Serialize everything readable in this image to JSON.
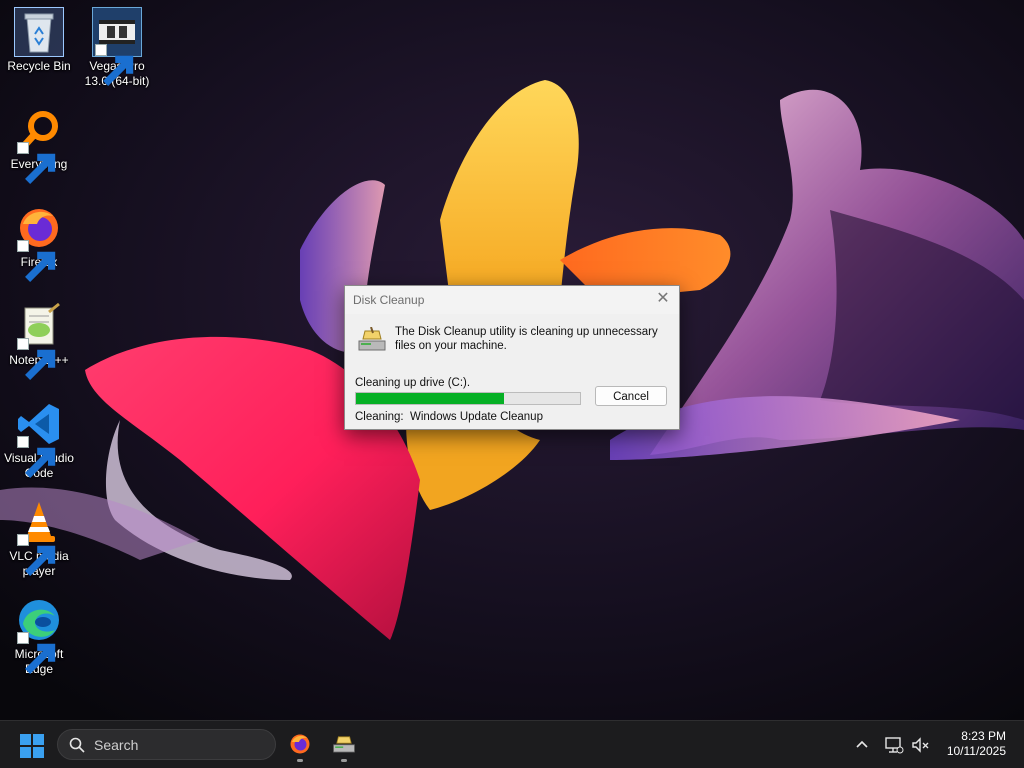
{
  "desktop": {
    "icons": [
      {
        "label": "Recycle Bin",
        "icon": "recycle-bin-icon"
      },
      {
        "label": "Vegas Pro 13.0 (64-bit)",
        "icon": "vegas-pro-icon"
      },
      {
        "label": "Everything",
        "icon": "everything-search-icon"
      },
      {
        "label": "Firefox",
        "icon": "firefox-icon"
      },
      {
        "label": "Notepad++",
        "icon": "notepad-plus-plus-icon"
      },
      {
        "label": "Visual Studio Code",
        "icon": "vscode-icon"
      },
      {
        "label": "VLC media player",
        "icon": "vlc-icon"
      },
      {
        "label": "Microsoft Edge",
        "icon": "edge-icon"
      }
    ]
  },
  "dialog": {
    "title": "Disk Cleanup",
    "message": "The Disk Cleanup utility is cleaning up unnecessary files on your machine.",
    "drive_status": "Cleaning up drive  (C:).",
    "progress_fraction": 0.66,
    "cleaning_label": "Cleaning:",
    "cleaning_item": "Windows Update Cleanup",
    "cancel_label": "Cancel"
  },
  "taskbar": {
    "search_placeholder": "Search",
    "apps": [
      "firefox-icon",
      "disk-cleanup-icon"
    ],
    "tray_icons": [
      "chevron-up-icon",
      "network-icon",
      "speaker-muted-icon"
    ],
    "time": "8:23 PM",
    "date": "10/11/2025"
  },
  "colors": {
    "progress_fill": "#06b025",
    "taskbar_bg": "#1c1c1e",
    "accent": "#0078d4"
  }
}
